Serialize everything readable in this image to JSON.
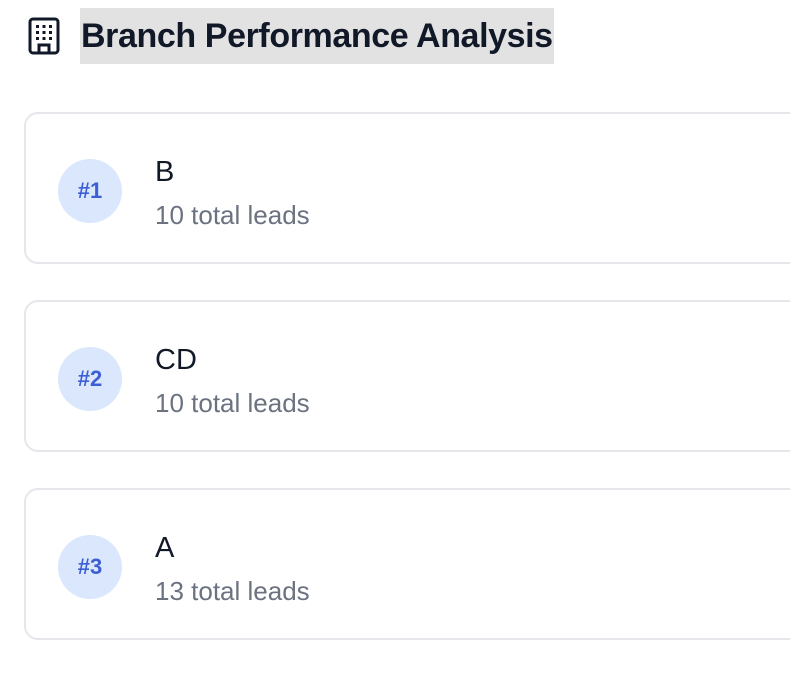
{
  "header": {
    "icon": "building-icon",
    "title": "Branch Performance Analysis"
  },
  "branches": [
    {
      "rank": "#1",
      "name": "B",
      "leads": "10 total leads"
    },
    {
      "rank": "#2",
      "name": "CD",
      "leads": "10 total leads"
    },
    {
      "rank": "#3",
      "name": "A",
      "leads": "13 total leads"
    }
  ],
  "colors": {
    "badge_bg": "#dbe7fd",
    "badge_text": "#3d5fd6",
    "card_border": "#e5e7eb",
    "muted_text": "#6b7280",
    "title_highlight": "#e2e2e2"
  }
}
